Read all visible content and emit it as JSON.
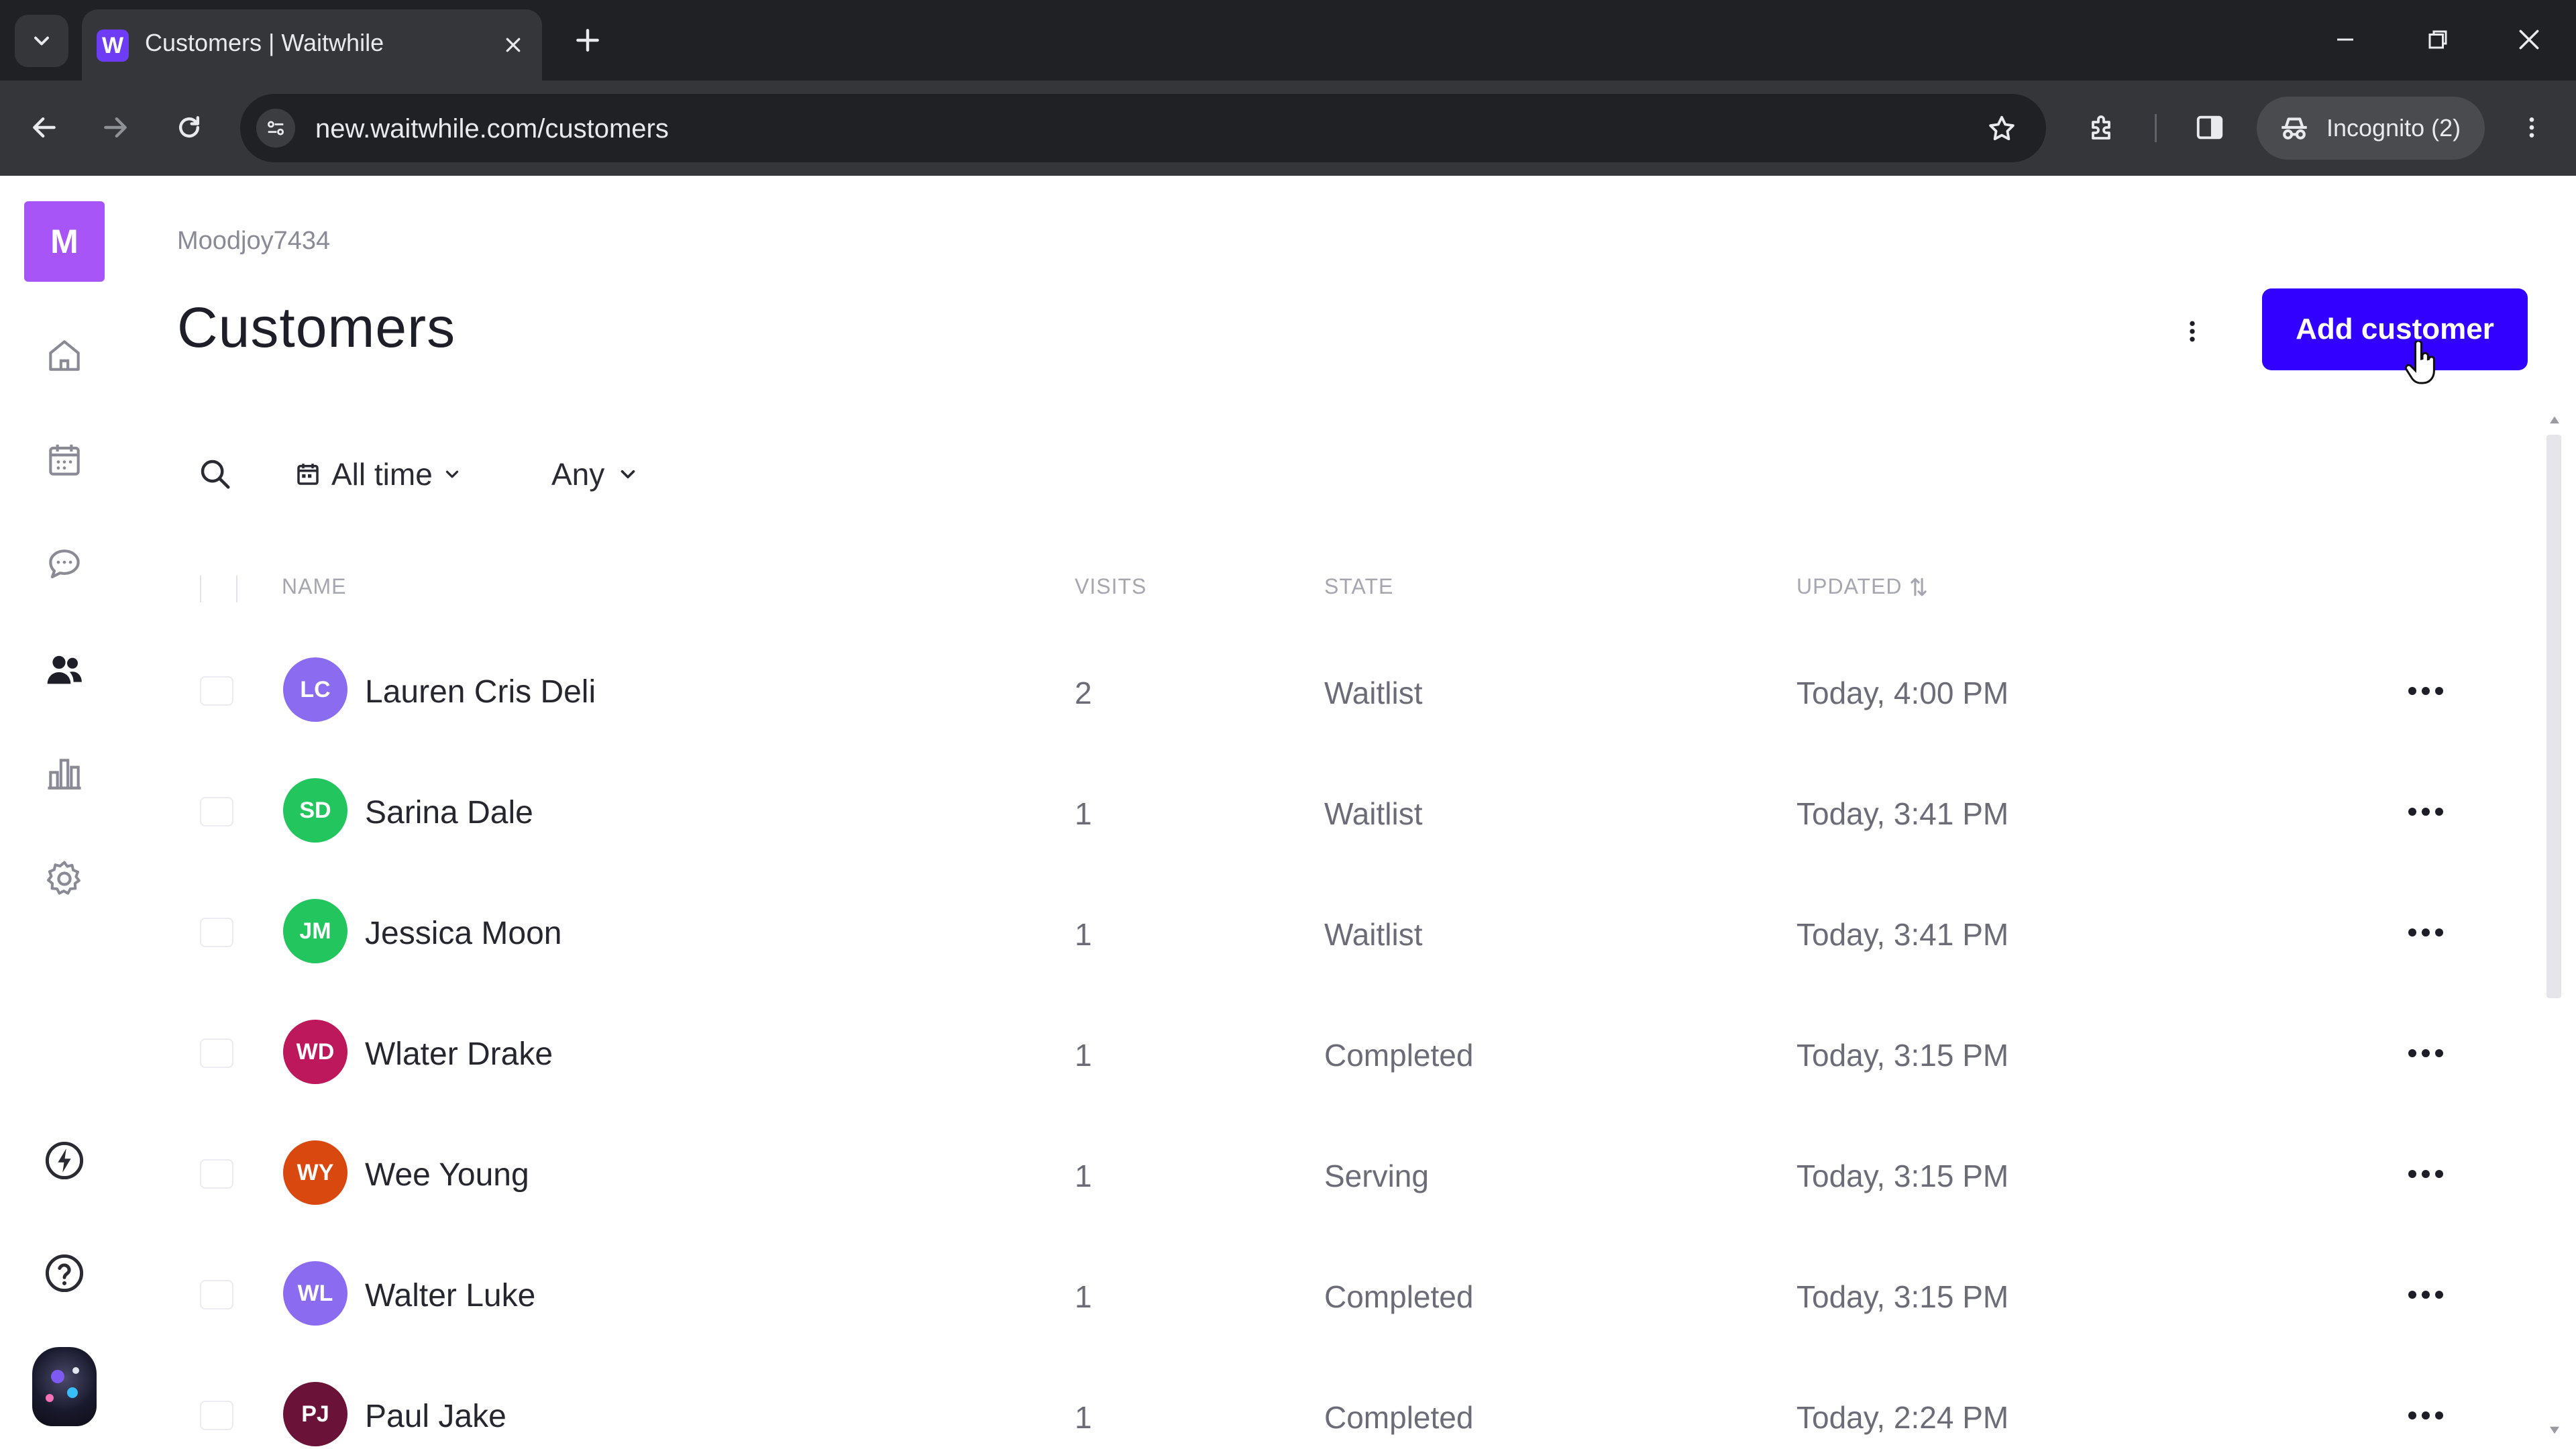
{
  "browser": {
    "tab_title": "Customers | Waitwhile",
    "favicon_letter": "W",
    "url": "new.waitwhile.com/customers",
    "incognito_label": "Incognito (2)"
  },
  "app": {
    "logo_letter": "M",
    "breadcrumb": "Moodjoy7434",
    "page_title": "Customers",
    "add_button_label": "Add customer",
    "brand_color": "#3200ff",
    "sidebar_icons": [
      "home-icon",
      "calendar-icon",
      "chat-icon",
      "people-icon",
      "analytics-icon",
      "settings-icon",
      "lightning-icon",
      "help-icon"
    ]
  },
  "filters": {
    "date_label": "All time",
    "state_label": "Any"
  },
  "table": {
    "columns": {
      "name": "NAME",
      "visits": "VISITS",
      "state": "STATE",
      "updated": "UPDATED"
    },
    "rows": [
      {
        "initials": "LC",
        "name": "Lauren Cris Deli",
        "visits": "2",
        "state": "Waitlist",
        "updated": "Today, 4:00 PM",
        "color": "#8b6cf0"
      },
      {
        "initials": "SD",
        "name": "Sarina Dale",
        "visits": "1",
        "state": "Waitlist",
        "updated": "Today, 3:41 PM",
        "color": "#22c55e"
      },
      {
        "initials": "JM",
        "name": "Jessica Moon",
        "visits": "1",
        "state": "Waitlist",
        "updated": "Today, 3:41 PM",
        "color": "#22c55e"
      },
      {
        "initials": "WD",
        "name": "Wlater Drake",
        "visits": "1",
        "state": "Completed",
        "updated": "Today, 3:15 PM",
        "color": "#be185d"
      },
      {
        "initials": "WY",
        "name": "Wee Young",
        "visits": "1",
        "state": "Serving",
        "updated": "Today, 3:15 PM",
        "color": "#d9480f"
      },
      {
        "initials": "WL",
        "name": "Walter Luke",
        "visits": "1",
        "state": "Completed",
        "updated": "Today, 3:15 PM",
        "color": "#8b6cf0"
      },
      {
        "initials": "PJ",
        "name": "Paul Jake",
        "visits": "1",
        "state": "Completed",
        "updated": "Today, 2:24 PM",
        "color": "#6b1238"
      }
    ]
  }
}
